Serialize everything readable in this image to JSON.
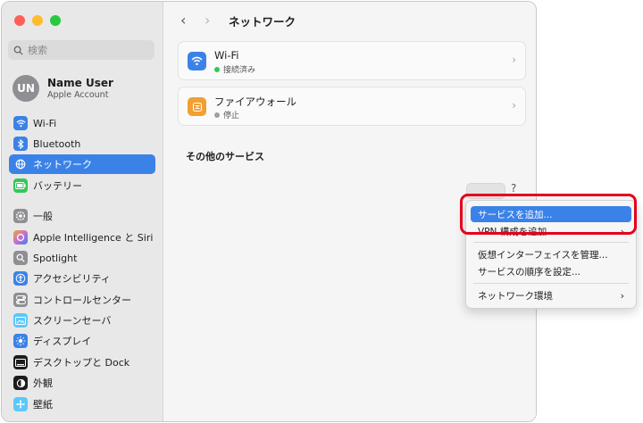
{
  "sidebar": {
    "search_placeholder": "検索",
    "account": {
      "initials": "UN",
      "name": "Name User",
      "subtitle": "Apple Account"
    },
    "items": [
      {
        "label": "Wi-Fi",
        "icon": "wifi-icon",
        "color": "#3b82e8"
      },
      {
        "label": "Bluetooth",
        "icon": "bluetooth-icon",
        "color": "#3b82e8"
      },
      {
        "label": "ネットワーク",
        "icon": "globe-icon",
        "color": "#3b82e8",
        "selected": true
      },
      {
        "label": "バッテリー",
        "icon": "battery-icon",
        "color": "#34c759"
      },
      {
        "label": "一般",
        "icon": "gear-icon",
        "color": "#8e8e93"
      },
      {
        "label": "Apple Intelligence と Siri",
        "icon": "siri-icon",
        "color": "#c86dd7"
      },
      {
        "label": "Spotlight",
        "icon": "magnifier-icon",
        "color": "#8e8e93"
      },
      {
        "label": "アクセシビリティ",
        "icon": "accessibility-icon",
        "color": "#3b82e8"
      },
      {
        "label": "コントロールセンター",
        "icon": "control-center-icon",
        "color": "#8e8e93"
      },
      {
        "label": "スクリーンセーバ",
        "icon": "screensaver-icon",
        "color": "#5ac8fa"
      },
      {
        "label": "ディスプレイ",
        "icon": "display-icon",
        "color": "#3b82e8"
      },
      {
        "label": "デスクトップと Dock",
        "icon": "dock-icon",
        "color": "#1d1d1f"
      },
      {
        "label": "外観",
        "icon": "appearance-icon",
        "color": "#1d1d1f"
      },
      {
        "label": "壁紙",
        "icon": "wallpaper-icon",
        "color": "#5ac8fa"
      }
    ]
  },
  "header": {
    "title": "ネットワーク",
    "back": "‹",
    "forward": "›"
  },
  "services": [
    {
      "name": "Wi-Fi",
      "status": "接続済み",
      "status_color": "#34c759",
      "icon": "wifi-icon",
      "icon_color": "#3b82e8"
    },
    {
      "name": "ファイアウォール",
      "status": "停止",
      "status_color": "#a0a0a0",
      "icon": "firewall-icon",
      "icon_color": "#f0a032"
    }
  ],
  "other_services_heading": "その他のサービス",
  "help_label": "?",
  "menu": {
    "items": [
      {
        "label": "サービスを追加...",
        "highlighted": true
      },
      {
        "label": "VPN 構成を追加",
        "submenu": true
      },
      {
        "label": "仮想インターフェイスを管理..."
      },
      {
        "label": "サービスの順序を設定..."
      },
      {
        "label": "ネットワーク環境",
        "submenu": true
      }
    ]
  },
  "colors": {
    "accent": "#3b82e8",
    "highlight_box": "#e4001b"
  }
}
